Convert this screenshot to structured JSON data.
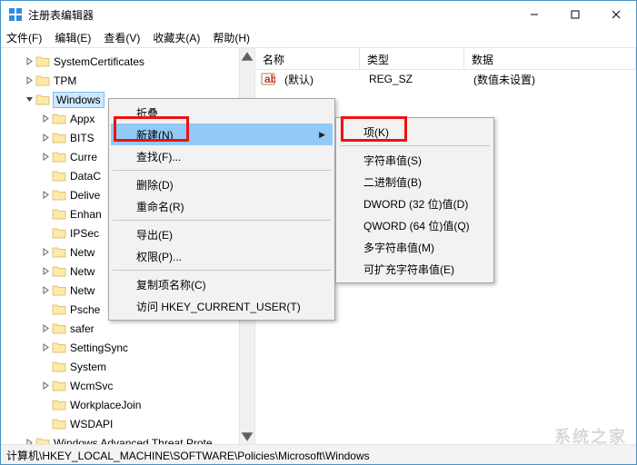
{
  "window": {
    "title": "注册表编辑器"
  },
  "menubar": [
    "文件(F)",
    "编辑(E)",
    "查看(V)",
    "收藏夹(A)",
    "帮助(H)"
  ],
  "tree": {
    "items": [
      {
        "depth": 1,
        "expander": "right",
        "label": "SystemCertificates"
      },
      {
        "depth": 1,
        "expander": "right",
        "label": "TPM"
      },
      {
        "depth": 1,
        "expander": "down",
        "label": "Windows",
        "selected": true
      },
      {
        "depth": 2,
        "expander": "right",
        "label": "Appx"
      },
      {
        "depth": 2,
        "expander": "right",
        "label": "BITS"
      },
      {
        "depth": 2,
        "expander": "right",
        "label": "Curre"
      },
      {
        "depth": 2,
        "expander": "none",
        "label": "DataC"
      },
      {
        "depth": 2,
        "expander": "right",
        "label": "Delive"
      },
      {
        "depth": 2,
        "expander": "none",
        "label": "Enhan"
      },
      {
        "depth": 2,
        "expander": "none",
        "label": "IPSec"
      },
      {
        "depth": 2,
        "expander": "right",
        "label": "Netw"
      },
      {
        "depth": 2,
        "expander": "right",
        "label": "Netw"
      },
      {
        "depth": 2,
        "expander": "right",
        "label": "Netw"
      },
      {
        "depth": 2,
        "expander": "none",
        "label": "Psche"
      },
      {
        "depth": 2,
        "expander": "right",
        "label": "safer"
      },
      {
        "depth": 2,
        "expander": "right",
        "label": "SettingSync"
      },
      {
        "depth": 2,
        "expander": "none",
        "label": "System"
      },
      {
        "depth": 2,
        "expander": "right",
        "label": "WcmSvc"
      },
      {
        "depth": 2,
        "expander": "none",
        "label": "WorkplaceJoin"
      },
      {
        "depth": 2,
        "expander": "none",
        "label": "WSDAPI"
      },
      {
        "depth": 1,
        "expander": "right",
        "label": "Windows Advanced Threat Prote"
      }
    ]
  },
  "list": {
    "headers": {
      "name": "名称",
      "type": "类型",
      "data": "数据"
    },
    "rows": [
      {
        "name": "(默认)",
        "type": "REG_SZ",
        "data": "(数值未设置)"
      }
    ]
  },
  "ctx_main": {
    "items": [
      {
        "label": "折叠",
        "kind": "item"
      },
      {
        "label": "新建(N)",
        "kind": "sub",
        "highlight": true
      },
      {
        "label": "查找(F)...",
        "kind": "item"
      },
      {
        "kind": "sep"
      },
      {
        "label": "删除(D)",
        "kind": "item"
      },
      {
        "label": "重命名(R)",
        "kind": "item"
      },
      {
        "kind": "sep"
      },
      {
        "label": "导出(E)",
        "kind": "item"
      },
      {
        "label": "权限(P)...",
        "kind": "item"
      },
      {
        "kind": "sep"
      },
      {
        "label": "复制项名称(C)",
        "kind": "item"
      },
      {
        "label": "访问 HKEY_CURRENT_USER(T)",
        "kind": "item"
      }
    ]
  },
  "ctx_sub": {
    "items": [
      {
        "label": "项(K)"
      },
      {
        "kind": "sep"
      },
      {
        "label": "字符串值(S)"
      },
      {
        "label": "二进制值(B)"
      },
      {
        "label": "DWORD (32 位)值(D)"
      },
      {
        "label": "QWORD (64 位)值(Q)"
      },
      {
        "label": "多字符串值(M)"
      },
      {
        "label": "可扩充字符串值(E)"
      }
    ]
  },
  "statusbar": "计算机\\HKEY_LOCAL_MACHINE\\SOFTWARE\\Policies\\Microsoft\\Windows",
  "watermark": "系统之家"
}
